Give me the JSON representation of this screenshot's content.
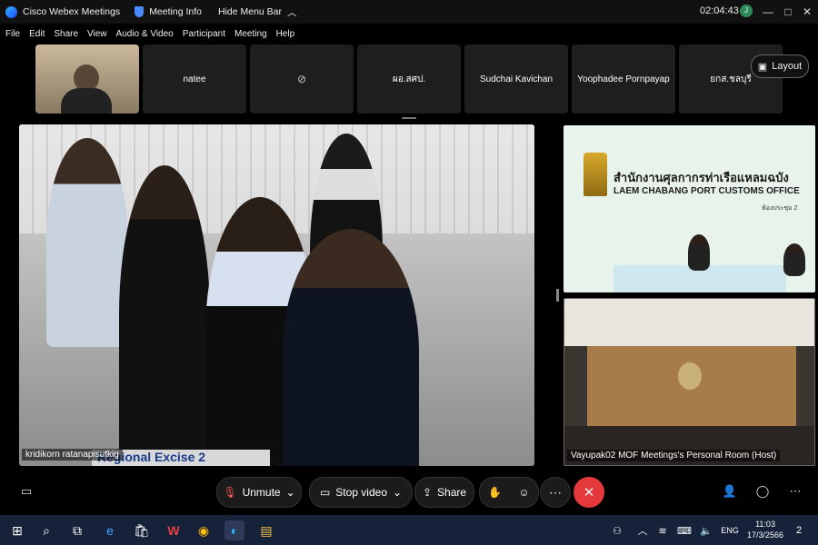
{
  "titlebar": {
    "app_name": "Cisco Webex Meetings",
    "meeting_info": "Meeting Info",
    "hide_menu": "Hide Menu Bar",
    "clock": "02:04:43",
    "status": "J"
  },
  "menu": [
    "File",
    "Edit",
    "Share",
    "View",
    "Audio & Video",
    "Participant",
    "Meeting",
    "Help"
  ],
  "filmstrip": {
    "participants": [
      "natee",
      "",
      "ผอ.สศป.",
      "Sudchai Kavichan",
      "Yoophadee Pornpayap",
      "ยกส.ชลบุรี"
    ],
    "layout_label": "Layout"
  },
  "main_video": {
    "label": "kridikorn ratanapisutkig",
    "banner": "Regional Excise 2"
  },
  "right_top": {
    "office_th": "สำนักงานศุลกากรท่าเรือแหลมฉบัง",
    "office_en": "LAEM CHABANG PORT CUSTOMS OFFICE",
    "room": "ห้องประชุม 2"
  },
  "right_bottom": {
    "label": "Vayupak02 MOF Meetings's Personal Room (Host)"
  },
  "controls": {
    "unmute": "Unmute",
    "stop_video": "Stop video",
    "share": "Share"
  },
  "taskbar": {
    "lang": "ENG",
    "time": "11:03",
    "date": "17/3/2566",
    "notifications": "2"
  },
  "colors": {
    "end_call": "#e5383b",
    "taskbar": "#16213a",
    "webex_blue": "#2fb5ff"
  }
}
